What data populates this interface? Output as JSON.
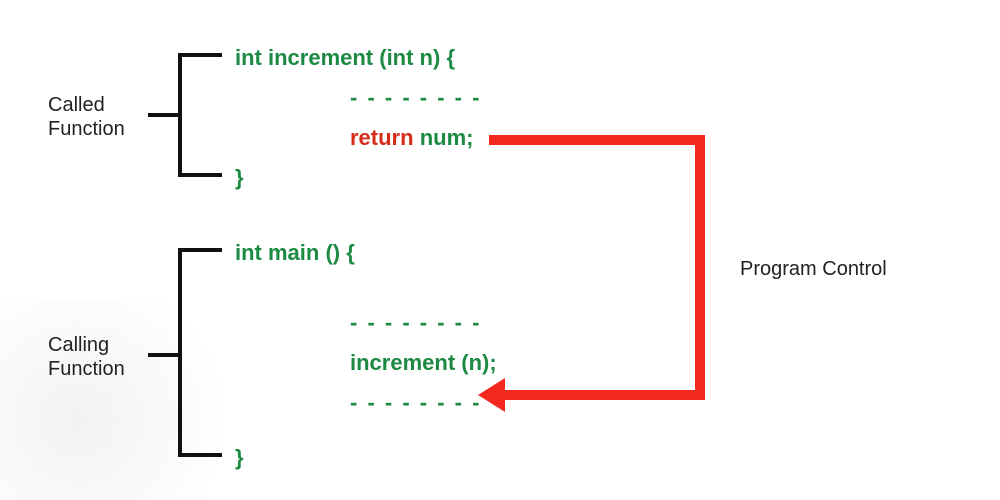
{
  "labels": {
    "called_line1": "Called",
    "called_line2": "Function",
    "calling_line1": "Calling",
    "calling_line2": "Function",
    "program_control": "Program Control"
  },
  "code": {
    "called": {
      "signature": "int increment (int n)   {",
      "body_dashes": "- - - - - - - -",
      "return_kw": "return ",
      "return_rest": "num;",
      "close": "}"
    },
    "main": {
      "signature": "int main ()   {",
      "dashes1": "- - - - - - - -",
      "call": "increment (n);",
      "dashes2": "- - - - - - - -",
      "close": "}"
    }
  },
  "colors": {
    "bracket": "#111111",
    "code_green": "#1c8a43",
    "code_red": "#d62c1a",
    "arrow_red": "#f4281e"
  }
}
